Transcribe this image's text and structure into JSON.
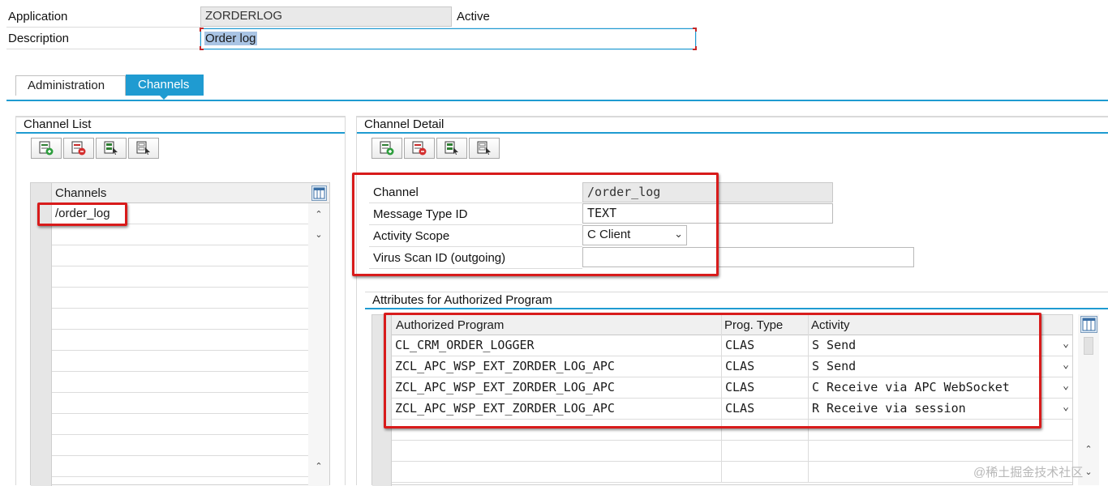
{
  "header": {
    "application_label": "Application",
    "application_value": "ZORDERLOG",
    "status": "Active",
    "description_label": "Description",
    "description_value": "Order log"
  },
  "tabs": [
    {
      "label": "Administration",
      "active": false
    },
    {
      "label": "Channels",
      "active": true
    }
  ],
  "channel_list": {
    "title": "Channel List",
    "column_header": "Channels",
    "rows": [
      "/order_log",
      "",
      "",
      "",
      "",
      "",
      "",
      "",
      "",
      "",
      "",
      "",
      ""
    ]
  },
  "channel_detail": {
    "title": "Channel Detail",
    "fields": {
      "channel_label": "Channel",
      "channel_value": "/order_log",
      "message_type_label": "Message Type ID",
      "message_type_value": "TEXT",
      "activity_scope_label": "Activity Scope",
      "activity_scope_value": "C Client",
      "virus_scan_label": "Virus Scan ID (outgoing)",
      "virus_scan_value": ""
    }
  },
  "authorized_programs": {
    "title": "Attributes for Authorized Program",
    "columns": [
      "Authorized Program",
      "Prog. Type",
      "Activity"
    ],
    "rows": [
      {
        "program": "CL_CRM_ORDER_LOGGER",
        "type": "CLAS",
        "activity": "S Send"
      },
      {
        "program": "ZCL_APC_WSP_EXT_ZORDER_LOG_APC",
        "type": "CLAS",
        "activity": "S Send"
      },
      {
        "program": "ZCL_APC_WSP_EXT_ZORDER_LOG_APC",
        "type": "CLAS",
        "activity": "C Receive via APC WebSocket"
      },
      {
        "program": "ZCL_APC_WSP_EXT_ZORDER_LOG_APC",
        "type": "CLAS",
        "activity": "R Receive via session"
      }
    ]
  },
  "watermark": "@稀土掘金技术社区",
  "colors": {
    "accent": "#1f9bd1",
    "highlight_box": "#d81b1b",
    "selection": "#a9c4e4"
  },
  "icons": [
    "insert-row-icon",
    "delete-row-icon",
    "select-all-icon",
    "deselect-all-icon",
    "column-settings-icon",
    "chevron-down-icon",
    "chevron-up-icon"
  ]
}
